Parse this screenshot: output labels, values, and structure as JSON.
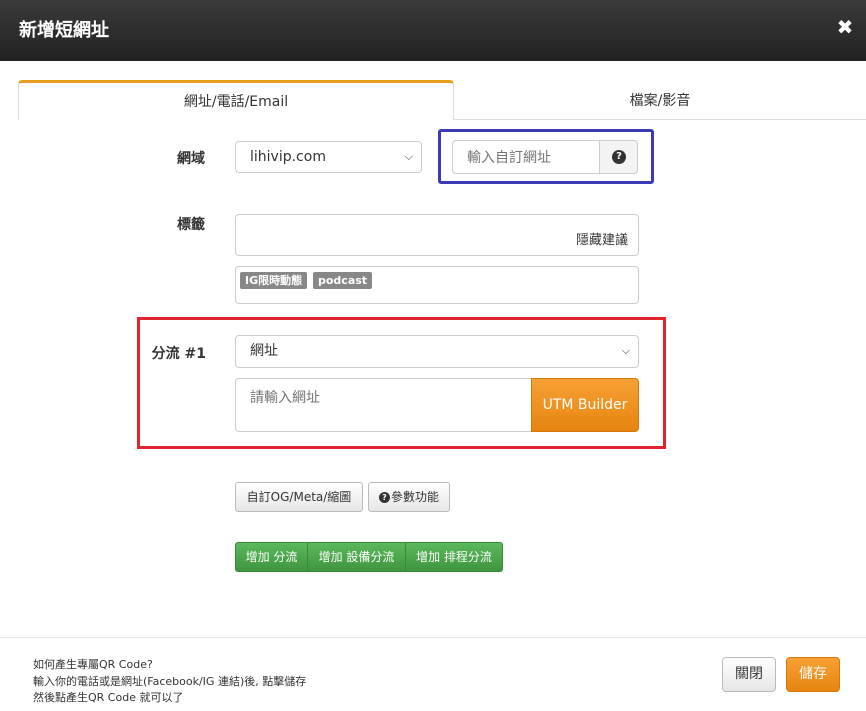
{
  "header": {
    "title": "新增短網址",
    "close_symbol": "✖"
  },
  "tabs": [
    {
      "label": "網址/電話/Email",
      "active": true
    },
    {
      "label": "檔案/影音",
      "active": false
    }
  ],
  "domain": {
    "label": "網域",
    "selected": "lihivip.com",
    "custom_placeholder": "輸入自訂網址",
    "help_symbol": "?"
  },
  "tags": {
    "label": "標籤",
    "hide_suggestions": "隱藏建議",
    "suggestions": [
      "IG限時動態",
      "podcast"
    ]
  },
  "split": {
    "label": "分流 #1",
    "type_selected": "網址",
    "url_placeholder": "請輸入網址",
    "utm_button": "UTM Builder"
  },
  "options": {
    "og_button": "自訂OG/Meta/縮圖",
    "params_button": "參數功能",
    "params_icon_symbol": "?"
  },
  "add_buttons": {
    "add_split": "增加 分流",
    "add_device_split": "增加 設備分流",
    "add_schedule_split": "增加 排程分流"
  },
  "footer": {
    "help_line1": "如何產生專屬QR Code?",
    "help_line2": "輸入你的電話或是網址(Facebook/IG 連結)後, 點擊儲存",
    "help_line3": "然後點產生QR Code 就可以了",
    "close_button": "關閉",
    "save_button": "儲存"
  },
  "colors": {
    "header_bg": "#2b2b2b",
    "tab_accent": "#e6a01e",
    "highlight_blue": "#3b3bb8",
    "highlight_red": "#e0252f",
    "orange_button": "#f0921e",
    "green_button": "#4cae4c"
  }
}
